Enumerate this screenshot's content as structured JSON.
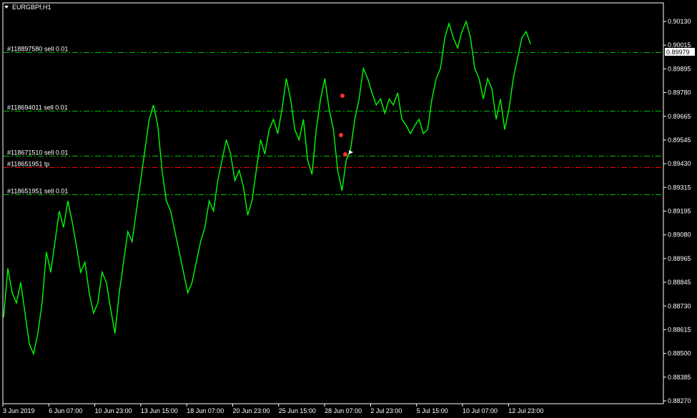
{
  "window": {
    "symbol_title": "EURGBPf,H1"
  },
  "chart_data": {
    "type": "line",
    "title": "EURGBPf,H1",
    "ylim": [
      0.8823,
      0.902
    ],
    "grid": false,
    "colors": {
      "background": "#000000",
      "price": "#00ff00",
      "axis": "#ffffff",
      "order_line": "#00c000",
      "tp_line": "#ff0000"
    },
    "current_price": "0.89979",
    "y_ticks": [
      "0.90130",
      "0.90015",
      "0.89895",
      "0.89780",
      "0.89665",
      "0.89545",
      "0.89430",
      "0.89315",
      "0.89195",
      "0.89080",
      "0.88965",
      "0.88845",
      "0.88730",
      "0.88615",
      "0.88500",
      "0.88385",
      "0.88270"
    ],
    "x_ticks": [
      "3 Jun 2019",
      "6 Jun 07:00",
      "10 Jun 23:00",
      "13 Jun 15:00",
      "18 Jun 07:00",
      "20 Jun 23:00",
      "25 Jun 15:00",
      "28 Jun 07:00",
      "2 Jul 23:00",
      "5 Jul 15:00",
      "10 Jul 07:00",
      "12 Jul 23:00"
    ],
    "order_lines": [
      {
        "label": "#118897580 sell 0.01",
        "price": 0.89979,
        "kind": "order"
      },
      {
        "label": "#118694011 sell 0.01",
        "price": 0.89692,
        "kind": "order"
      },
      {
        "label": "#118671510 sell 0.01",
        "price": 0.8947,
        "kind": "order"
      },
      {
        "label": "#118651951 sell 0.01",
        "price": 0.89283,
        "kind": "order"
      },
      {
        "label": "#118651951 tp",
        "price": 0.89415,
        "kind": "tp"
      }
    ],
    "series": [
      {
        "values": [
          0.8868,
          0.8892,
          0.888,
          0.8875,
          0.8885,
          0.887,
          0.8855,
          0.885,
          0.886,
          0.8875,
          0.89,
          0.889,
          0.8905,
          0.892,
          0.8912,
          0.8925,
          0.8915,
          0.8903,
          0.889,
          0.8895,
          0.888,
          0.887,
          0.8875,
          0.889,
          0.8885,
          0.8872,
          0.886,
          0.888,
          0.8895,
          0.891,
          0.8905,
          0.892,
          0.8935,
          0.895,
          0.8965,
          0.8972,
          0.8962,
          0.894,
          0.8925,
          0.892,
          0.891,
          0.89,
          0.889,
          0.888,
          0.8885,
          0.8895,
          0.8905,
          0.8912,
          0.8925,
          0.892,
          0.8935,
          0.8945,
          0.8955,
          0.8948,
          0.8935,
          0.894,
          0.8932,
          0.8918,
          0.8925,
          0.894,
          0.8955,
          0.8948,
          0.896,
          0.8965,
          0.8958,
          0.897,
          0.8985,
          0.8975,
          0.896,
          0.8955,
          0.8965,
          0.8945,
          0.8938,
          0.896,
          0.8975,
          0.8985,
          0.897,
          0.896,
          0.894,
          0.893,
          0.8945,
          0.895,
          0.8965,
          0.8975,
          0.899,
          0.8985,
          0.8978,
          0.8972,
          0.8975,
          0.8968,
          0.8975,
          0.8972,
          0.8978,
          0.8965,
          0.8962,
          0.8958,
          0.8962,
          0.8965,
          0.8958,
          0.896,
          0.8975,
          0.8985,
          0.899,
          0.9005,
          0.9012,
          0.9005,
          0.9,
          0.9008,
          0.9013,
          0.9005,
          0.899,
          0.8985,
          0.8975,
          0.8985,
          0.898,
          0.8965,
          0.8975,
          0.896,
          0.897,
          0.8985,
          0.8995,
          0.9005,
          0.9008,
          0.9002
        ]
      }
    ]
  }
}
